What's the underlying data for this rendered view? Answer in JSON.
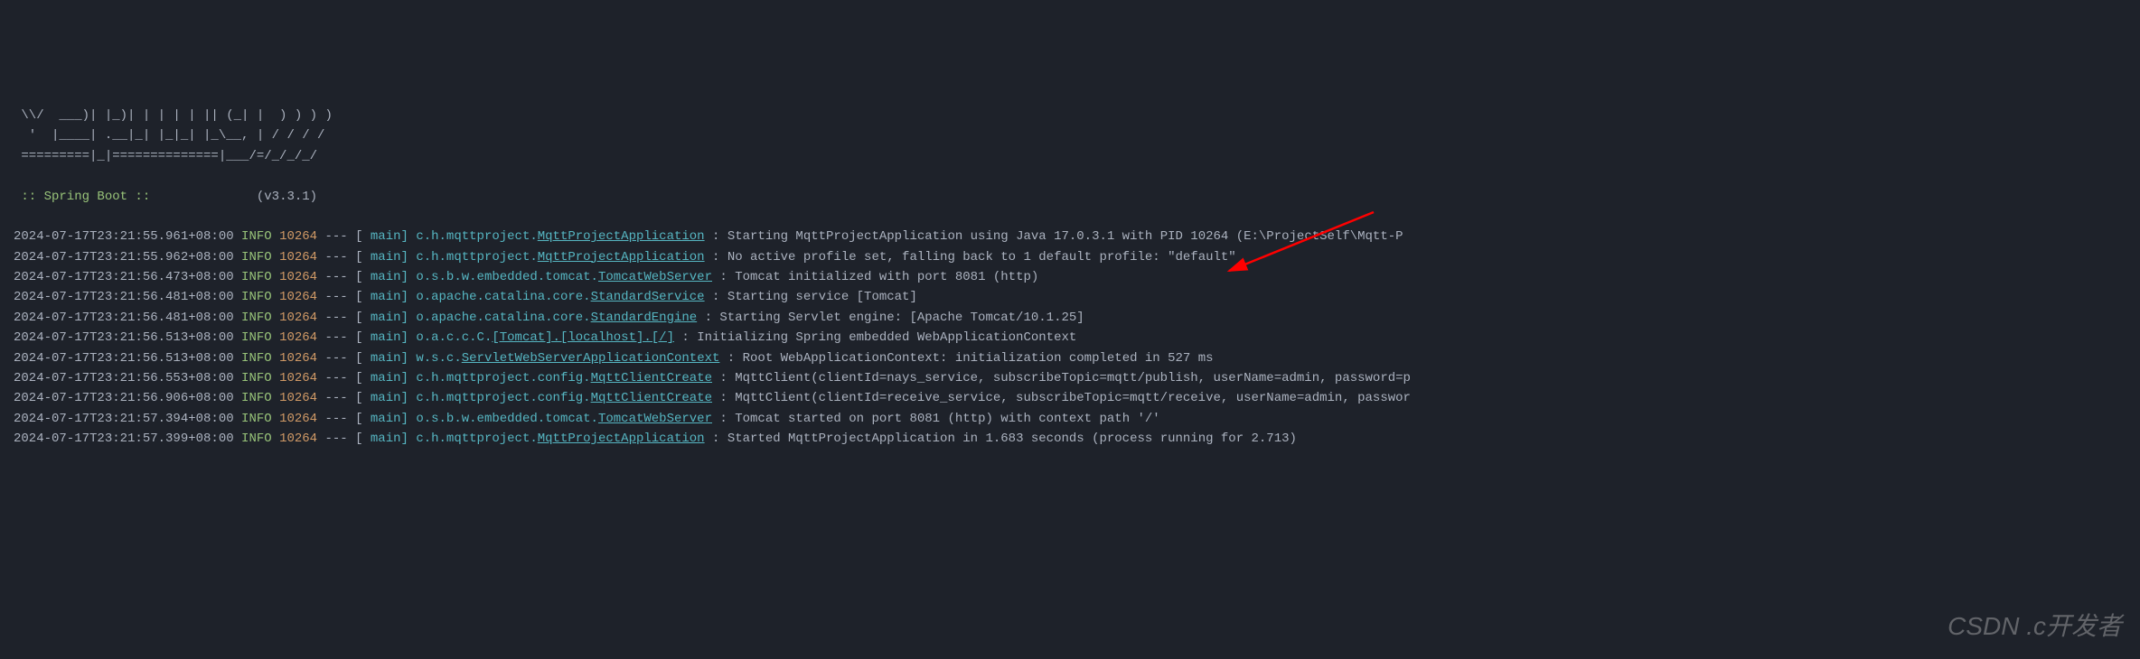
{
  "banner": {
    "line1": " \\\\/  ___)| |_)| | | | | || (_| |  ) ) ) )",
    "line2": "  '  |____| .__|_| |_|_| |_\\__, | / / / /",
    "line3": " =========|_|==============|___/=/_/_/_/"
  },
  "springBoot": {
    "label": " :: Spring Boot :: ",
    "version": "(v3.3.1)"
  },
  "logs": [
    {
      "timestamp": "2024-07-17T23:21:55.961+08:00",
      "level": "INFO",
      "pid": "10264",
      "thread": "main",
      "loggerPrefix": "c.h.mqttproject.",
      "loggerClass": "MqttProjectApplication",
      "message": "Starting MqttProjectApplication using Java 17.0.3.1 with PID 10264 (E:\\ProjectSelf\\Mqtt-P"
    },
    {
      "timestamp": "2024-07-17T23:21:55.962+08:00",
      "level": "INFO",
      "pid": "10264",
      "thread": "main",
      "loggerPrefix": "c.h.mqttproject.",
      "loggerClass": "MqttProjectApplication",
      "message": "No active profile set, falling back to 1 default profile: \"default\""
    },
    {
      "timestamp": "2024-07-17T23:21:56.473+08:00",
      "level": "INFO",
      "pid": "10264",
      "thread": "main",
      "loggerPrefix": "o.s.b.w.embedded.tomcat.",
      "loggerClass": "TomcatWebServer",
      "message": "Tomcat initialized with port 8081 (http)"
    },
    {
      "timestamp": "2024-07-17T23:21:56.481+08:00",
      "level": "INFO",
      "pid": "10264",
      "thread": "main",
      "loggerPrefix": "o.apache.catalina.core.",
      "loggerClass": "StandardService",
      "message": "Starting service [Tomcat]"
    },
    {
      "timestamp": "2024-07-17T23:21:56.481+08:00",
      "level": "INFO",
      "pid": "10264",
      "thread": "main",
      "loggerPrefix": "o.apache.catalina.core.",
      "loggerClass": "StandardEngine",
      "message": "Starting Servlet engine: [Apache Tomcat/10.1.25]"
    },
    {
      "timestamp": "2024-07-17T23:21:56.513+08:00",
      "level": "INFO",
      "pid": "10264",
      "thread": "main",
      "loggerPrefix": "o.a.c.c.C.",
      "loggerClass": "[Tomcat].[localhost].[/]",
      "message": "Initializing Spring embedded WebApplicationContext"
    },
    {
      "timestamp": "2024-07-17T23:21:56.513+08:00",
      "level": "INFO",
      "pid": "10264",
      "thread": "main",
      "loggerPrefix": "w.s.c.",
      "loggerClass": "ServletWebServerApplicationContext",
      "message": "Root WebApplicationContext: initialization completed in 527 ms"
    },
    {
      "timestamp": "2024-07-17T23:21:56.553+08:00",
      "level": "INFO",
      "pid": "10264",
      "thread": "main",
      "loggerPrefix": "c.h.mqttproject.config.",
      "loggerClass": "MqttClientCreate",
      "message": "MqttClient(clientId=nays_service, subscribeTopic=mqtt/publish, userName=admin, password=p"
    },
    {
      "timestamp": "2024-07-17T23:21:56.906+08:00",
      "level": "INFO",
      "pid": "10264",
      "thread": "main",
      "loggerPrefix": "c.h.mqttproject.config.",
      "loggerClass": "MqttClientCreate",
      "message": "MqttClient(clientId=receive_service, subscribeTopic=mqtt/receive, userName=admin, passwor"
    },
    {
      "timestamp": "2024-07-17T23:21:57.394+08:00",
      "level": "INFO",
      "pid": "10264",
      "thread": "main",
      "loggerPrefix": "o.s.b.w.embedded.tomcat.",
      "loggerClass": "TomcatWebServer",
      "message": "Tomcat started on port 8081 (http) with context path '/'"
    },
    {
      "timestamp": "2024-07-17T23:21:57.399+08:00",
      "level": "INFO",
      "pid": "10264",
      "thread": "main",
      "loggerPrefix": "c.h.mqttproject.",
      "loggerClass": "MqttProjectApplication",
      "message": "Started MqttProjectApplication in 1.683 seconds (process running for 2.713)"
    }
  ],
  "watermark": "CSDN .c开发者"
}
